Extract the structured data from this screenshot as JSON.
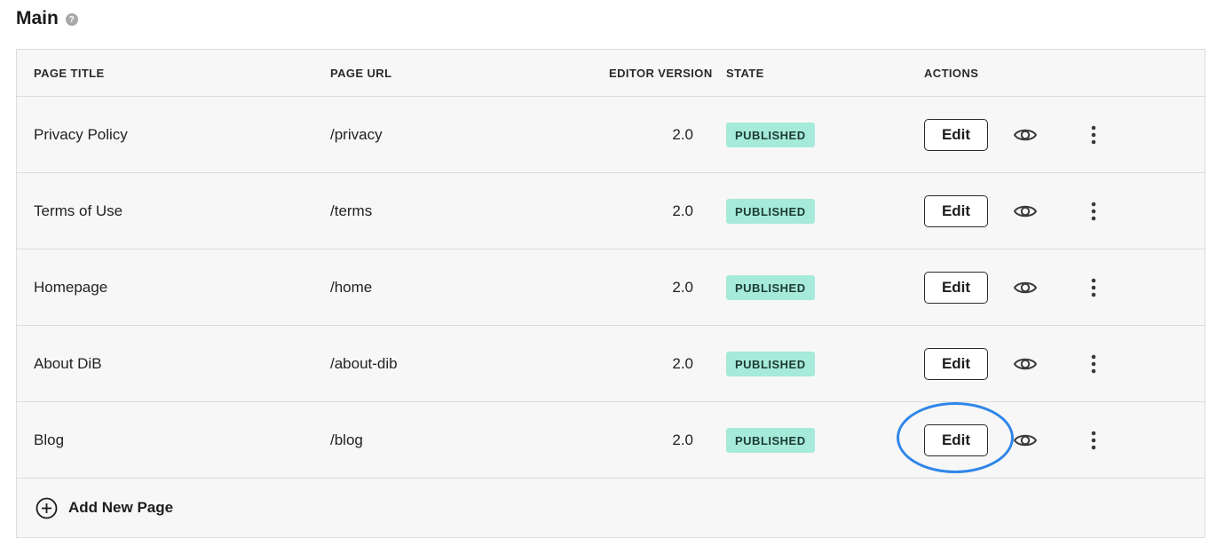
{
  "section": {
    "title": "Main",
    "help_icon": "question-circle-icon"
  },
  "table": {
    "columns": {
      "title": "PAGE TITLE",
      "url": "PAGE URL",
      "version": "EDITOR VERSION",
      "state": "STATE",
      "actions": "ACTIONS"
    },
    "rows": [
      {
        "title": "Privacy Policy",
        "url": "/privacy",
        "version": "2.0",
        "state": "PUBLISHED",
        "edit_label": "Edit"
      },
      {
        "title": "Terms of Use",
        "url": "/terms",
        "version": "2.0",
        "state": "PUBLISHED",
        "edit_label": "Edit"
      },
      {
        "title": "Homepage",
        "url": "/home",
        "version": "2.0",
        "state": "PUBLISHED",
        "edit_label": "Edit"
      },
      {
        "title": "About DiB",
        "url": "/about-dib",
        "version": "2.0",
        "state": "PUBLISHED",
        "edit_label": "Edit"
      },
      {
        "title": "Blog",
        "url": "/blog",
        "version": "2.0",
        "state": "PUBLISHED",
        "edit_label": "Edit"
      }
    ],
    "row_icons": [
      "eye-icon",
      "vertical-dots-icon"
    ],
    "add_label": "Add New Page",
    "add_icon": "plus-circle-icon"
  },
  "colors": {
    "published_badge_bg": "#a6ead9",
    "highlight": "#2f86e8"
  }
}
